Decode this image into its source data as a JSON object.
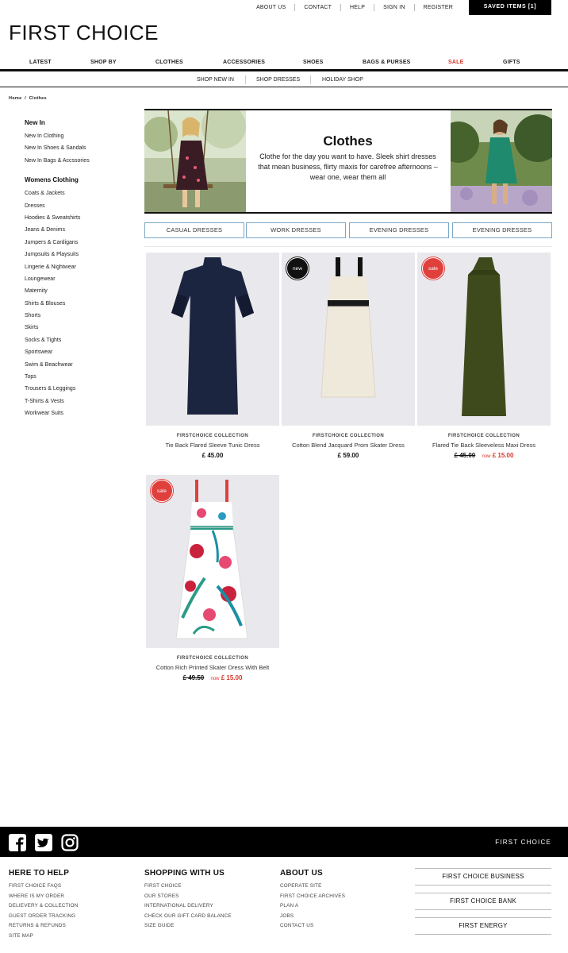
{
  "header": {
    "util_links": [
      "ABOUT US",
      "CONTACT",
      "HELP",
      "SIGN IN",
      "REGISTER"
    ],
    "saved_items": "SAVED ITEMS [1]",
    "logo": "FIRST CHOICE"
  },
  "nav": {
    "main": [
      "LATEST",
      "SHOP BY",
      "CLOTHES",
      "ACCESSORIES",
      "SHOES",
      "BAGS & PURSES",
      "SALE",
      "GIFTS"
    ],
    "sub": [
      "SHOP NEW IN",
      "SHOP DRESSES",
      "HOLIDAY SHOP"
    ],
    "sale_color": "#d9352a"
  },
  "breadcrumb": {
    "home": "Home",
    "sep": "/",
    "current": "Clothes"
  },
  "sidebar": {
    "new_heading": "New In",
    "new_items": [
      "New In Clothing",
      "New In Shoes & Sandals",
      "New In Bags & Accssories"
    ],
    "womens_heading": "Womens Clothing",
    "womens_items": [
      "Coats & Jackets",
      "Dresses",
      "Hoodies & Sweatshirts",
      "Jeans & Denims",
      "Jumpers & Cardigans",
      "Jumpsuits & Playsuits",
      "Lingerie & Nightwear",
      "Loungewear",
      "Maternity",
      "Shirts & Blouses",
      "Shorts",
      "Skirts",
      "Socks & Tights",
      "Sportswear",
      "Swim & Beachwear",
      "Tops",
      "Trousers & Leggings",
      "T-Shirts & Vests",
      "Workwear Suits"
    ]
  },
  "banner": {
    "title": "Clothes",
    "description": "Clothe for the day you want to have. Sleek shirt dresses that mean business, flirty maxis for carefree afternoons – wear one, wear them all"
  },
  "categories": [
    "CASUAL DRESSES",
    "WORK DRESSES",
    "EVENING DRESSES",
    "EVENING DRESSES"
  ],
  "products": [
    {
      "brand": "FIRSTCHOICE COLLECTION",
      "name": "Tie Back Flared Sleeve Tunic Dress",
      "price": "£ 45.00",
      "badge": "",
      "was": "",
      "now_label": "",
      "now": "",
      "dress_color": "#1c2540"
    },
    {
      "brand": "FIRSTCHOICE COLLECTION",
      "name": "Cotton Blend Jacquard Prom Skater Dress",
      "price": "£ 59.00",
      "badge": "new",
      "was": "",
      "now_label": "",
      "now": "",
      "dress_color": "#efe9dc"
    },
    {
      "brand": "FIRSTCHOICE COLLECTION",
      "name": "Flared Tie Back Sleeveless Maxi Dress",
      "price": "",
      "badge": "sale",
      "was": "£ 45.00",
      "now_label": "now",
      "now": "£ 15.00",
      "dress_color": "#3f4a1c"
    },
    {
      "brand": "FIRSTCHOICE COLLECTION",
      "name": "Cotton Rich Printed Skater Dress With Belt",
      "price": "",
      "badge": "sale",
      "was": "£ 49.50",
      "now_label": "now",
      "now": "£ 15.00",
      "dress_color": "#ffffff"
    }
  ],
  "footer": {
    "brand": "FIRST  CHOICE",
    "social_icons": [
      "facebook-icon",
      "twitter-icon",
      "instagram-icon"
    ],
    "col1": {
      "heading": "HERE TO HELP",
      "links": [
        "FIRST CHOICE FAQS",
        "WHERE IS MY ORDER",
        "DELIEVERY & COLLECTION",
        "GUEST ORDER TRACKING",
        "RETURNS & REFUNDS",
        "SITE MAP"
      ]
    },
    "col2": {
      "heading": "SHOPPING WITH US",
      "links": [
        "FIRST CHOICE",
        "OUR STORES",
        "INTERNATIONAL DELIVERY",
        "CHECK OUR GIFT CARD BALANCE",
        "SIZE GUIDE"
      ]
    },
    "col3": {
      "heading": "ABOUT US",
      "links": [
        "COPERATE SITE",
        "FIRST CHOICE ARCHIVES",
        "PLAN A",
        "JOBS",
        "CONTACT US"
      ]
    },
    "buttons": [
      "FIRST CHOICE BUSINESS",
      "FIRST CHOICE BANK",
      "FIRST ENERGY"
    ]
  }
}
